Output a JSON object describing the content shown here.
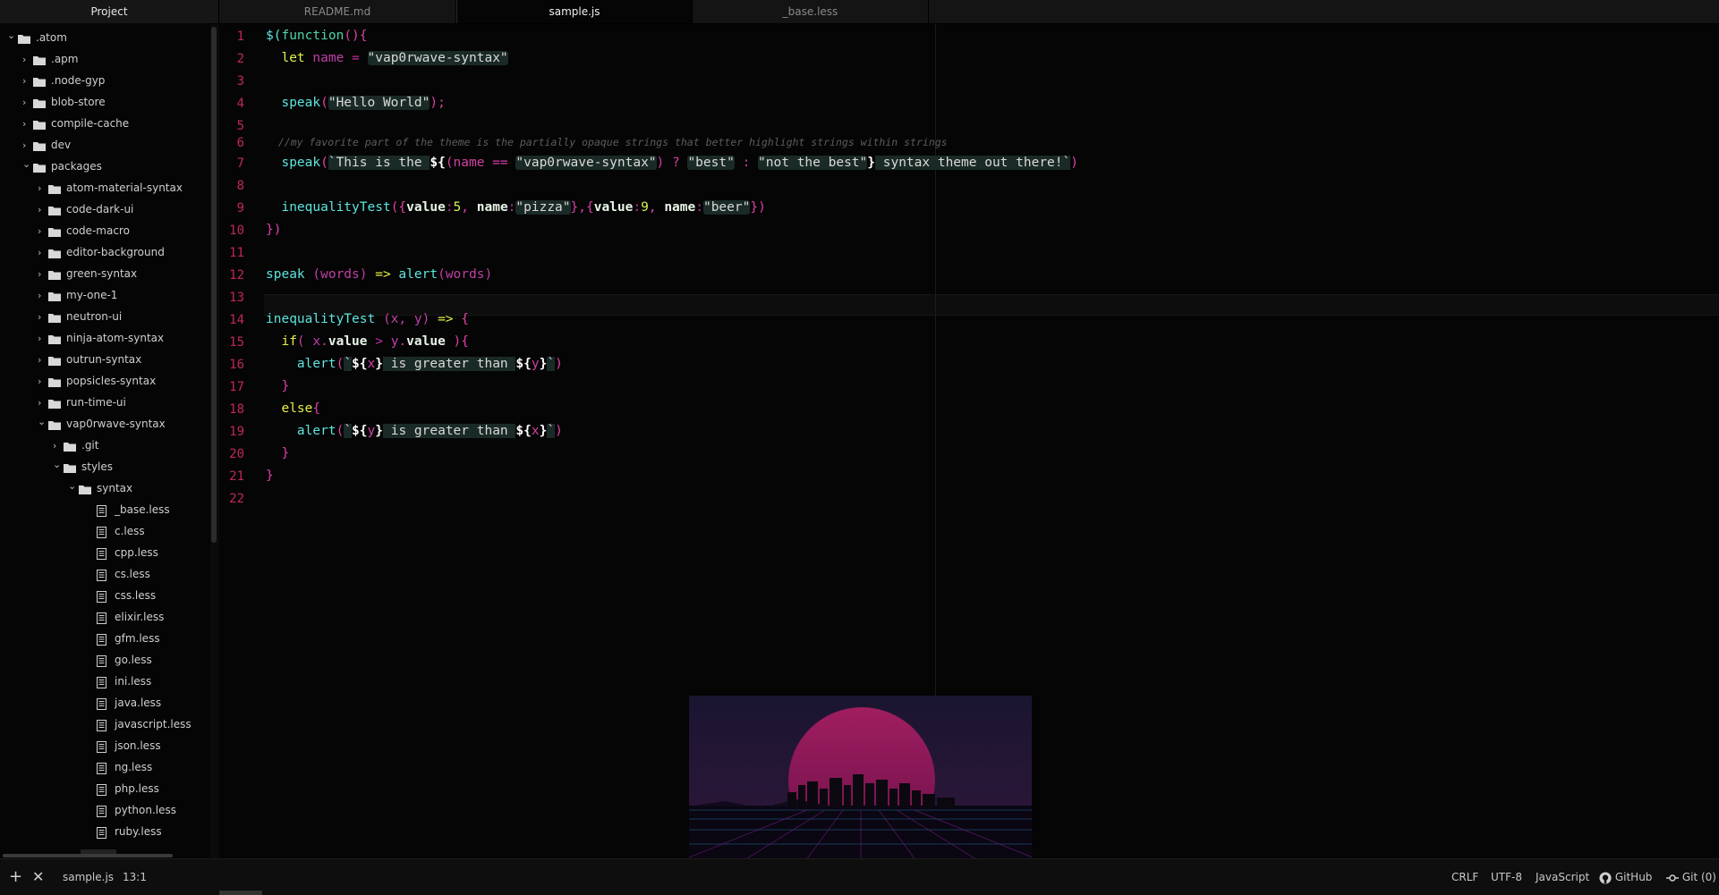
{
  "tabs": {
    "project": "Project",
    "items": [
      {
        "label": "README.md",
        "active": false
      },
      {
        "label": "sample.js",
        "active": true
      },
      {
        "label": "_base.less",
        "active": false
      }
    ]
  },
  "tree": [
    {
      "label": ".atom",
      "type": "folder",
      "depth": 0,
      "open": true
    },
    {
      "label": ".apm",
      "type": "folder",
      "depth": 1,
      "open": false
    },
    {
      "label": ".node-gyp",
      "type": "folder",
      "depth": 1,
      "open": false
    },
    {
      "label": "blob-store",
      "type": "folder",
      "depth": 1,
      "open": false
    },
    {
      "label": "compile-cache",
      "type": "folder",
      "depth": 1,
      "open": false
    },
    {
      "label": "dev",
      "type": "folder",
      "depth": 1,
      "open": false
    },
    {
      "label": "packages",
      "type": "folder",
      "depth": 1,
      "open": true
    },
    {
      "label": "atom-material-syntax",
      "type": "folder",
      "depth": 2,
      "open": false
    },
    {
      "label": "code-dark-ui",
      "type": "folder",
      "depth": 2,
      "open": false
    },
    {
      "label": "code-macro",
      "type": "folder",
      "depth": 2,
      "open": false
    },
    {
      "label": "editor-background",
      "type": "folder",
      "depth": 2,
      "open": false
    },
    {
      "label": "green-syntax",
      "type": "folder",
      "depth": 2,
      "open": false
    },
    {
      "label": "my-one-1",
      "type": "folder",
      "depth": 2,
      "open": false
    },
    {
      "label": "neutron-ui",
      "type": "folder",
      "depth": 2,
      "open": false
    },
    {
      "label": "ninja-atom-syntax",
      "type": "folder",
      "depth": 2,
      "open": false
    },
    {
      "label": "outrun-syntax",
      "type": "folder",
      "depth": 2,
      "open": false
    },
    {
      "label": "popsicles-syntax",
      "type": "folder",
      "depth": 2,
      "open": false
    },
    {
      "label": "run-time-ui",
      "type": "folder",
      "depth": 2,
      "open": false
    },
    {
      "label": "vap0rwave-syntax",
      "type": "folder",
      "depth": 2,
      "open": true
    },
    {
      "label": ".git",
      "type": "folder",
      "depth": 3,
      "open": false
    },
    {
      "label": "styles",
      "type": "folder",
      "depth": 3,
      "open": true
    },
    {
      "label": "syntax",
      "type": "folder",
      "depth": 4,
      "open": true
    },
    {
      "label": "_base.less",
      "type": "file",
      "depth": 5
    },
    {
      "label": "c.less",
      "type": "file",
      "depth": 5
    },
    {
      "label": "cpp.less",
      "type": "file",
      "depth": 5
    },
    {
      "label": "cs.less",
      "type": "file",
      "depth": 5
    },
    {
      "label": "css.less",
      "type": "file",
      "depth": 5
    },
    {
      "label": "elixir.less",
      "type": "file",
      "depth": 5
    },
    {
      "label": "gfm.less",
      "type": "file",
      "depth": 5
    },
    {
      "label": "go.less",
      "type": "file",
      "depth": 5
    },
    {
      "label": "ini.less",
      "type": "file",
      "depth": 5
    },
    {
      "label": "java.less",
      "type": "file",
      "depth": 5
    },
    {
      "label": "javascript.less",
      "type": "file",
      "depth": 5
    },
    {
      "label": "json.less",
      "type": "file",
      "depth": 5
    },
    {
      "label": "ng.less",
      "type": "file",
      "depth": 5
    },
    {
      "label": "php.less",
      "type": "file",
      "depth": 5
    },
    {
      "label": "python.less",
      "type": "file",
      "depth": 5
    },
    {
      "label": "ruby.less",
      "type": "file",
      "depth": 5
    }
  ],
  "code": [
    [
      [
        "$(",
        "fn"
      ],
      [
        "function",
        "fp"
      ],
      [
        "(){",
        "pun"
      ]
    ],
    [
      [
        "  let ",
        "kw"
      ],
      [
        "name",
        "var"
      ],
      [
        " = ",
        "op"
      ],
      [
        "\"vap0rwave-syntax\"",
        "str"
      ]
    ],
    [],
    [
      [
        "  speak",
        "fn"
      ],
      [
        "(",
        "pun"
      ],
      [
        "\"Hello World\"",
        "str"
      ],
      [
        ");",
        "pun"
      ]
    ],
    [],
    [
      [
        "  //my favorite part of the theme is the partially opaque strings that better highlight strings within strings",
        "cmt"
      ]
    ],
    [
      [
        "  speak",
        "fn"
      ],
      [
        "(",
        "pun"
      ],
      [
        "`This is the ",
        "tpl"
      ],
      [
        "${",
        "interp"
      ],
      [
        "(name == ",
        "ivar"
      ],
      [
        "\"vap0rwave-syntax\"",
        "str"
      ],
      [
        ") ? ",
        "ivar"
      ],
      [
        "\"best\"",
        "str"
      ],
      [
        " : ",
        "ivar"
      ],
      [
        "\"not the best\"",
        "str"
      ],
      [
        "}",
        "interp"
      ],
      [
        " syntax theme out there!`",
        "tpl"
      ],
      [
        ")",
        "pun"
      ]
    ],
    [],
    [
      [
        "  inequalityTest",
        "fn"
      ],
      [
        "({",
        "pun"
      ],
      [
        "value",
        "key"
      ],
      [
        ":",
        "op"
      ],
      [
        "5",
        "num"
      ],
      [
        ", ",
        "pun"
      ],
      [
        "name",
        "key"
      ],
      [
        ":",
        "op"
      ],
      [
        "\"pizza\"",
        "str"
      ],
      [
        "},{",
        "pun"
      ],
      [
        "value",
        "key"
      ],
      [
        ":",
        "op"
      ],
      [
        "9",
        "num"
      ],
      [
        ", ",
        "pun"
      ],
      [
        "name",
        "key"
      ],
      [
        ":",
        "op"
      ],
      [
        "\"beer\"",
        "str"
      ],
      [
        "})",
        "pun"
      ]
    ],
    [
      [
        "})",
        "pun"
      ]
    ],
    [],
    [
      [
        "speak",
        "fn"
      ],
      [
        " (words) ",
        "var"
      ],
      [
        "=>",
        "kw"
      ],
      [
        " alert",
        "fn"
      ],
      [
        "(words)",
        "var"
      ]
    ],
    [],
    [
      [
        "inequalityTest",
        "fn"
      ],
      [
        " (x, y) ",
        "var"
      ],
      [
        "=>",
        "kw"
      ],
      [
        " {",
        "pun"
      ]
    ],
    [
      [
        "  if",
        "kw"
      ],
      [
        "( x.",
        "var"
      ],
      [
        "value",
        "key"
      ],
      [
        " > ",
        "op"
      ],
      [
        "y.",
        "var"
      ],
      [
        "value",
        "key"
      ],
      [
        " ){",
        "pun"
      ]
    ],
    [
      [
        "    alert",
        "fn"
      ],
      [
        "(",
        "pun"
      ],
      [
        "`",
        "tpl"
      ],
      [
        "${",
        "interp"
      ],
      [
        "x",
        "ivar"
      ],
      [
        "}",
        "interp"
      ],
      [
        " is greater than ",
        "tpl"
      ],
      [
        "${",
        "interp"
      ],
      [
        "y",
        "ivar"
      ],
      [
        "}",
        "interp"
      ],
      [
        "`",
        "tpl"
      ],
      [
        ")",
        "pun"
      ]
    ],
    [
      [
        "  }",
        "pun"
      ]
    ],
    [
      [
        "  else",
        "kw"
      ],
      [
        "{",
        "pun"
      ]
    ],
    [
      [
        "    alert",
        "fn"
      ],
      [
        "(",
        "pun"
      ],
      [
        "`",
        "tpl"
      ],
      [
        "${",
        "interp"
      ],
      [
        "y",
        "ivar"
      ],
      [
        "}",
        "interp"
      ],
      [
        " is greater than ",
        "tpl"
      ],
      [
        "${",
        "interp"
      ],
      [
        "x",
        "ivar"
      ],
      [
        "}",
        "interp"
      ],
      [
        "`",
        "tpl"
      ],
      [
        ")",
        "pun"
      ]
    ],
    [
      [
        "  }",
        "pun"
      ]
    ],
    [
      [
        "}",
        "pun"
      ]
    ],
    []
  ],
  "line_numbers": [
    "1",
    "2",
    "3",
    "4",
    "5",
    "6",
    "7",
    "8",
    "9",
    "10",
    "11",
    "12",
    "13",
    "14",
    "15",
    "16",
    "17",
    "18",
    "19",
    "20",
    "21",
    "22"
  ],
  "status": {
    "file": "sample.js",
    "cursor": "13:1",
    "line_ending": "CRLF",
    "encoding": "UTF-8",
    "grammar": "JavaScript",
    "github": "GitHub",
    "git": "Git (0)"
  },
  "colors": {
    "background": "#050505",
    "line_number": "#c0265f",
    "function": "#5ce6e0",
    "keyword": "#e6f04a",
    "punctuation": "#e03fa6",
    "string_bg": "#1a2a26"
  },
  "icons": {
    "folder": "folder-icon",
    "file": "file-text-icon",
    "chevron_open": "chevron-down-icon",
    "chevron_closed": "chevron-right-icon",
    "add": "plus-icon",
    "close": "close-icon",
    "github": "github-icon",
    "git": "git-commit-icon"
  }
}
